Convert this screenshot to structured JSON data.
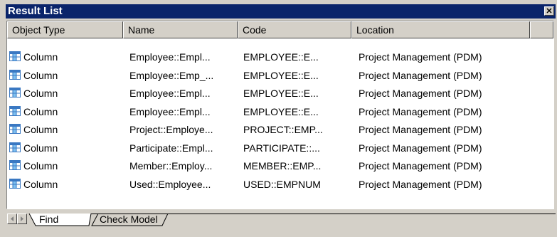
{
  "window": {
    "title": "Result List",
    "close_glyph": "✕"
  },
  "columns": [
    "Object Type",
    "Name",
    "Code",
    "Location",
    ""
  ],
  "rows": [
    {
      "type": "Column",
      "name": "Employee::Empl...",
      "code": "EMPLOYEE::E...",
      "location": "Project Management (PDM)"
    },
    {
      "type": "Column",
      "name": "Employee::Emp_...",
      "code": "EMPLOYEE::E...",
      "location": "Project Management (PDM)"
    },
    {
      "type": "Column",
      "name": "Employee::Empl...",
      "code": "EMPLOYEE::E...",
      "location": "Project Management (PDM)"
    },
    {
      "type": "Column",
      "name": "Employee::Empl...",
      "code": "EMPLOYEE::E...",
      "location": "Project Management (PDM)"
    },
    {
      "type": "Column",
      "name": "Project::Employe...",
      "code": "PROJECT::EMP...",
      "location": "Project Management (PDM)"
    },
    {
      "type": "Column",
      "name": "Participate::Empl...",
      "code": "PARTICIPATE::...",
      "location": "Project Management (PDM)"
    },
    {
      "type": "Column",
      "name": "Member::Employ...",
      "code": "MEMBER::EMP...",
      "location": "Project Management (PDM)"
    },
    {
      "type": "Column",
      "name": "Used::Employee...",
      "code": "USED::EMPNUM",
      "location": "Project Management (PDM)"
    }
  ],
  "tabs": [
    "Find",
    "Check Model"
  ],
  "colors": {
    "title_bg": "#0a246a",
    "face": "#d4d0c8",
    "icon_blue": "#3a78c2"
  }
}
